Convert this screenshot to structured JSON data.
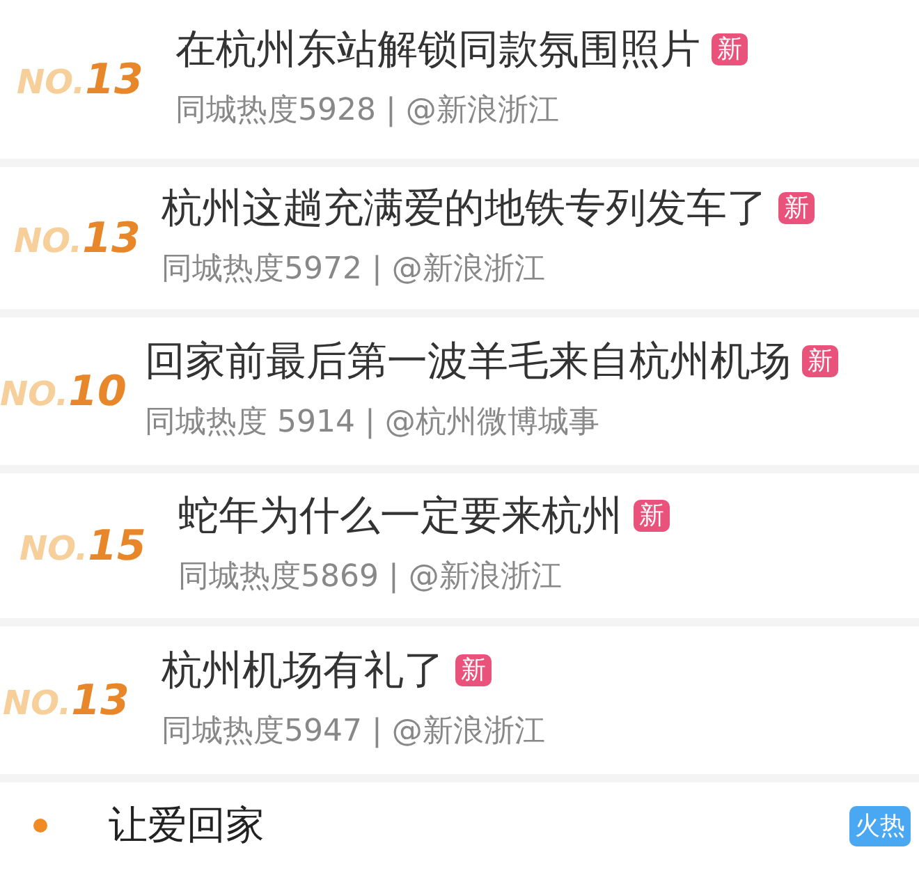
{
  "trending": [
    {
      "rank_prefix": "NO.",
      "rank": "13",
      "title": "在杭州东站解锁同款氛围照片",
      "badge": "新",
      "meta": "同城热度5928 | @新浪浙江"
    },
    {
      "rank_prefix": "NO.",
      "rank": "13",
      "title": "杭州这趟充满爱的地铁专列发车了",
      "badge": "新",
      "meta": "同城热度5972 | @新浪浙江"
    },
    {
      "rank_prefix": "NO.",
      "rank": "10",
      "title": "回家前最后第一波羊毛来自杭州机场",
      "badge": "新",
      "meta": "同城热度 5914 | @杭州微博城事"
    },
    {
      "rank_prefix": "NO.",
      "rank": "15",
      "title": "蛇年为什么一定要来杭州",
      "badge": "新",
      "meta": "同城热度5869 | @新浪浙江"
    },
    {
      "rank_prefix": "NO.",
      "rank": "13",
      "title": "杭州机场有礼了",
      "badge": "新",
      "meta": "同城热度5947 | @新浪浙江"
    }
  ],
  "hot_topic": {
    "title": "让爱回家",
    "badge": "火热"
  }
}
